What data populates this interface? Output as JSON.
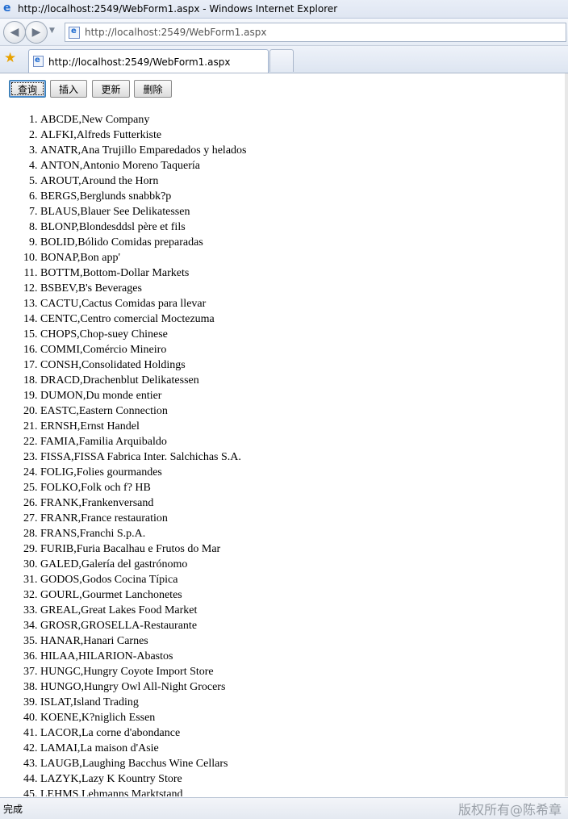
{
  "window": {
    "title": "http://localhost:2549/WebForm1.aspx - Windows Internet Explorer"
  },
  "address_bar": {
    "url": "http://localhost:2549/WebForm1.aspx"
  },
  "tab": {
    "label": "http://localhost:2549/WebForm1.aspx"
  },
  "buttons": {
    "query": "查询",
    "insert": "插入",
    "update": "更新",
    "delete": "删除"
  },
  "customers": [
    "ABCDE,New Company",
    "ALFKI,Alfreds Futterkiste",
    "ANATR,Ana Trujillo Emparedados y helados",
    "ANTON,Antonio Moreno Taquería",
    "AROUT,Around the Horn",
    "BERGS,Berglunds snabbk?p",
    "BLAUS,Blauer See Delikatessen",
    "BLONP,Blondesddsl père et fils",
    "BOLID,Bólido Comidas preparadas",
    "BONAP,Bon app'",
    "BOTTM,Bottom-Dollar Markets",
    "BSBEV,B's Beverages",
    "CACTU,Cactus Comidas para llevar",
    "CENTC,Centro comercial Moctezuma",
    "CHOPS,Chop-suey Chinese",
    "COMMI,Comércio Mineiro",
    "CONSH,Consolidated Holdings",
    "DRACD,Drachenblut Delikatessen",
    "DUMON,Du monde entier",
    "EASTC,Eastern Connection",
    "ERNSH,Ernst Handel",
    "FAMIA,Familia Arquibaldo",
    "FISSA,FISSA Fabrica Inter. Salchichas S.A.",
    "FOLIG,Folies gourmandes",
    "FOLKO,Folk och f? HB",
    "FRANK,Frankenversand",
    "FRANR,France restauration",
    "FRANS,Franchi S.p.A.",
    "FURIB,Furia Bacalhau e Frutos do Mar",
    "GALED,Galería del gastrónomo",
    "GODOS,Godos Cocina Típica",
    "GOURL,Gourmet Lanchonetes",
    "GREAL,Great Lakes Food Market",
    "GROSR,GROSELLA-Restaurante",
    "HANAR,Hanari Carnes",
    "HILAA,HILARION-Abastos",
    "HUNGC,Hungry Coyote Import Store",
    "HUNGO,Hungry Owl All-Night Grocers",
    "ISLAT,Island Trading",
    "KOENE,K?niglich Essen",
    "LACOR,La corne d'abondance",
    "LAMAI,La maison d'Asie",
    "LAUGB,Laughing Bacchus Wine Cellars",
    "LAZYK,Lazy K Kountry Store",
    "LEHMS,Lehmanns Marktstand"
  ],
  "status": {
    "text": "完成",
    "watermark": "版权所有@陈希章"
  },
  "icons": {
    "browser": "ie-logo-icon",
    "back": "back-arrow-icon",
    "forward": "forward-arrow-icon",
    "favorites": "favorites-star-icon",
    "page": "page-icon"
  }
}
